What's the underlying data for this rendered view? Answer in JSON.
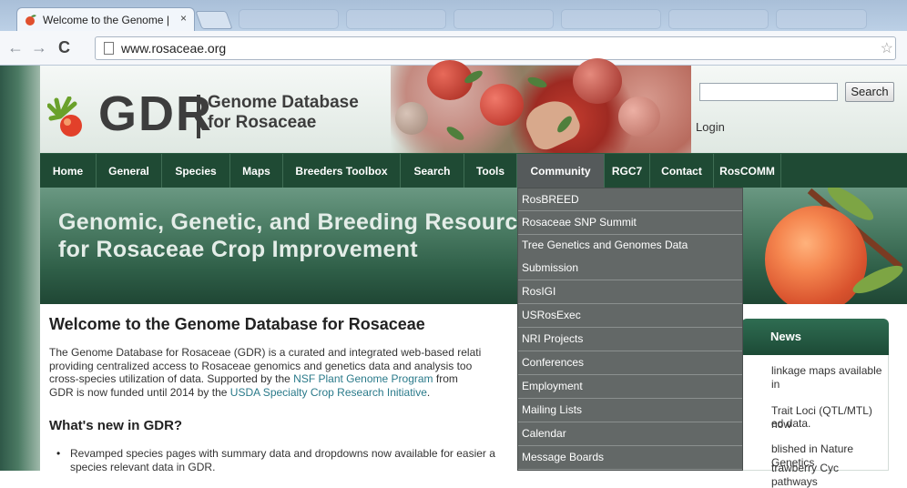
{
  "browser": {
    "tab_title": "Welcome to the Genome |",
    "tab_close": "×",
    "url": "www.rosaceae.org"
  },
  "site": {
    "logo_text": "GDR",
    "logo_sub1": "Genome Database",
    "logo_sub2": "for Rosaceae",
    "search": {
      "placeholder": "",
      "button_label": "Search"
    },
    "login_label": "Login",
    "nav": [
      "Home",
      "General",
      "Species",
      "Maps",
      "Breeders Toolbox",
      "Search",
      "Tools",
      "Community",
      "RGC7",
      "Contact",
      "RosCOMM"
    ],
    "nav_active": "Community",
    "banner_line1": "Genomic, Genetic, and Breeding Resources",
    "banner_line2": "for Rosaceae Crop Improvement",
    "welcome_title": "Welcome to the Genome Database for Rosaceae",
    "intro": {
      "p1": "The Genome Database for Rosaceae (GDR) is a curated and integrated web-based relati",
      "p2": "providing centralized access to Rosaceae genomics and genetics data and analysis too",
      "p3a": "cross-species utilization of data.   Supported by the ",
      "p3_link": "NSF Plant Genome Program",
      "p3b": " from",
      "p4a": "GDR is now funded until 2014 by the ",
      "p4_link": "USDA Specialty Crop Research Initiative",
      "p4b": "."
    },
    "whats_new_title": "What's new in GDR?",
    "bullet_char": "•",
    "bullet_1": "Revamped species pages with summary data and dropdowns now available for easier a",
    "bullet_1_cont": "species relevant data in GDR.",
    "news": {
      "title": "News",
      "items": [
        "linkage maps available in",
        "Trait Loci (QTL/MTL) now",
        "ed data.",
        "blished in Nature Genetics",
        "trawberry Cyc pathways"
      ]
    },
    "community_menu": [
      "RosBREED",
      "Rosaceae SNP Summit",
      "Tree Genetics and Genomes Data",
      "Submission",
      "RosIGI",
      "USRosExec",
      "NRI Projects",
      "Conferences",
      "Employment",
      "Mailing Lists",
      "Calendar",
      "Message Boards"
    ]
  }
}
